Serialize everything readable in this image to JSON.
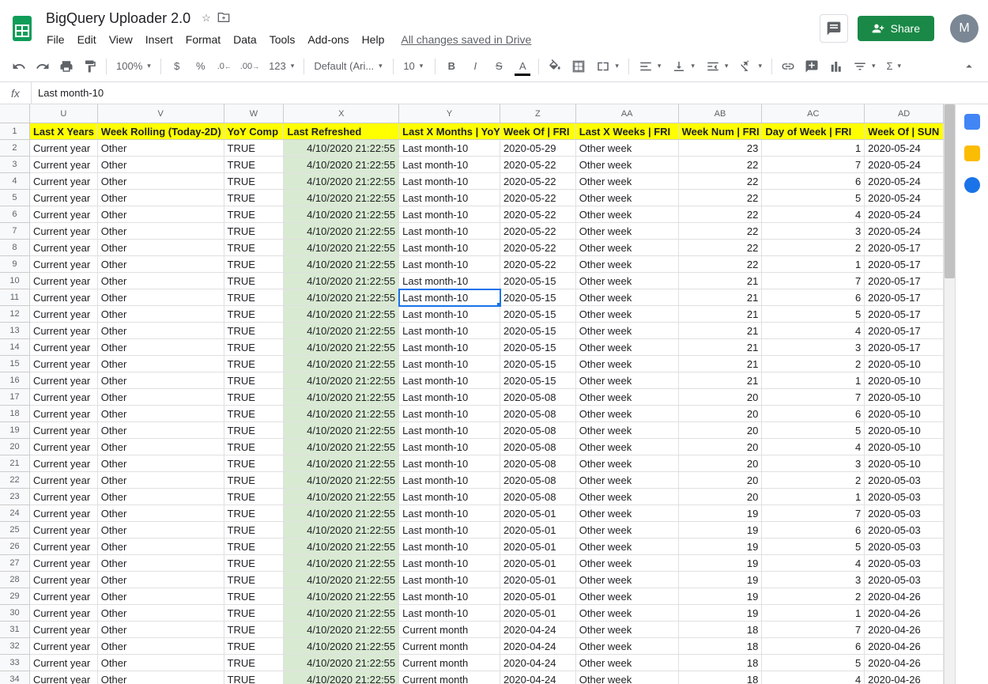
{
  "header": {
    "title": "BigQuery Uploader 2.0",
    "saved": "All changes saved in Drive",
    "share": "Share",
    "avatar": "M"
  },
  "menu": [
    "File",
    "Edit",
    "View",
    "Insert",
    "Format",
    "Data",
    "Tools",
    "Add-ons",
    "Help"
  ],
  "toolbar": {
    "zoom": "100%",
    "currency": "$",
    "percent": "%",
    "dec_dec": ".0",
    "dec_inc": ".00",
    "more_fmt": "123",
    "font": "Default (Ari...",
    "size": "10"
  },
  "formula": {
    "fx": "fx",
    "value": "Last month-10"
  },
  "columns": [
    {
      "id": "U",
      "label": "U",
      "header": "Last X Years",
      "cls": "cU"
    },
    {
      "id": "V",
      "label": "V",
      "header": "Week Rolling (Today-2D)",
      "cls": "cV"
    },
    {
      "id": "W",
      "label": "W",
      "header": "YoY Comp",
      "cls": "cW"
    },
    {
      "id": "X",
      "label": "X",
      "header": "Last Refreshed",
      "cls": "cX"
    },
    {
      "id": "Y",
      "label": "Y",
      "header": "Last X Months | YoY",
      "cls": "cY"
    },
    {
      "id": "Z",
      "label": "Z",
      "header": "Week Of | FRI",
      "cls": "cZ"
    },
    {
      "id": "AA",
      "label": "AA",
      "header": "Last X Weeks | FRI",
      "cls": "cAA"
    },
    {
      "id": "AB",
      "label": "AB",
      "header": "Week Num | FRI",
      "cls": "cAB"
    },
    {
      "id": "AC",
      "label": "AC",
      "header": "Day of Week | FRI",
      "cls": "cAC"
    },
    {
      "id": "AD",
      "label": "AD",
      "header": "Week Of | SUN",
      "cls": "cAD"
    }
  ],
  "selected": {
    "row": 11,
    "col": "Y"
  },
  "rows": [
    {
      "n": 2,
      "U": "Current year",
      "V": "Other",
      "W": "TRUE",
      "X": "4/10/2020 21:22:55",
      "Y": "Last month-10",
      "Z": "2020-05-29",
      "AA": "Other week",
      "AB": "23",
      "AC": "1",
      "AD": "2020-05-24"
    },
    {
      "n": 3,
      "U": "Current year",
      "V": "Other",
      "W": "TRUE",
      "X": "4/10/2020 21:22:55",
      "Y": "Last month-10",
      "Z": "2020-05-22",
      "AA": "Other week",
      "AB": "22",
      "AC": "7",
      "AD": "2020-05-24"
    },
    {
      "n": 4,
      "U": "Current year",
      "V": "Other",
      "W": "TRUE",
      "X": "4/10/2020 21:22:55",
      "Y": "Last month-10",
      "Z": "2020-05-22",
      "AA": "Other week",
      "AB": "22",
      "AC": "6",
      "AD": "2020-05-24"
    },
    {
      "n": 5,
      "U": "Current year",
      "V": "Other",
      "W": "TRUE",
      "X": "4/10/2020 21:22:55",
      "Y": "Last month-10",
      "Z": "2020-05-22",
      "AA": "Other week",
      "AB": "22",
      "AC": "5",
      "AD": "2020-05-24"
    },
    {
      "n": 6,
      "U": "Current year",
      "V": "Other",
      "W": "TRUE",
      "X": "4/10/2020 21:22:55",
      "Y": "Last month-10",
      "Z": "2020-05-22",
      "AA": "Other week",
      "AB": "22",
      "AC": "4",
      "AD": "2020-05-24"
    },
    {
      "n": 7,
      "U": "Current year",
      "V": "Other",
      "W": "TRUE",
      "X": "4/10/2020 21:22:55",
      "Y": "Last month-10",
      "Z": "2020-05-22",
      "AA": "Other week",
      "AB": "22",
      "AC": "3",
      "AD": "2020-05-24"
    },
    {
      "n": 8,
      "U": "Current year",
      "V": "Other",
      "W": "TRUE",
      "X": "4/10/2020 21:22:55",
      "Y": "Last month-10",
      "Z": "2020-05-22",
      "AA": "Other week",
      "AB": "22",
      "AC": "2",
      "AD": "2020-05-17"
    },
    {
      "n": 9,
      "U": "Current year",
      "V": "Other",
      "W": "TRUE",
      "X": "4/10/2020 21:22:55",
      "Y": "Last month-10",
      "Z": "2020-05-22",
      "AA": "Other week",
      "AB": "22",
      "AC": "1",
      "AD": "2020-05-17"
    },
    {
      "n": 10,
      "U": "Current year",
      "V": "Other",
      "W": "TRUE",
      "X": "4/10/2020 21:22:55",
      "Y": "Last month-10",
      "Z": "2020-05-15",
      "AA": "Other week",
      "AB": "21",
      "AC": "7",
      "AD": "2020-05-17"
    },
    {
      "n": 11,
      "U": "Current year",
      "V": "Other",
      "W": "TRUE",
      "X": "4/10/2020 21:22:55",
      "Y": "Last month-10",
      "Z": "2020-05-15",
      "AA": "Other week",
      "AB": "21",
      "AC": "6",
      "AD": "2020-05-17"
    },
    {
      "n": 12,
      "U": "Current year",
      "V": "Other",
      "W": "TRUE",
      "X": "4/10/2020 21:22:55",
      "Y": "Last month-10",
      "Z": "2020-05-15",
      "AA": "Other week",
      "AB": "21",
      "AC": "5",
      "AD": "2020-05-17"
    },
    {
      "n": 13,
      "U": "Current year",
      "V": "Other",
      "W": "TRUE",
      "X": "4/10/2020 21:22:55",
      "Y": "Last month-10",
      "Z": "2020-05-15",
      "AA": "Other week",
      "AB": "21",
      "AC": "4",
      "AD": "2020-05-17"
    },
    {
      "n": 14,
      "U": "Current year",
      "V": "Other",
      "W": "TRUE",
      "X": "4/10/2020 21:22:55",
      "Y": "Last month-10",
      "Z": "2020-05-15",
      "AA": "Other week",
      "AB": "21",
      "AC": "3",
      "AD": "2020-05-17"
    },
    {
      "n": 15,
      "U": "Current year",
      "V": "Other",
      "W": "TRUE",
      "X": "4/10/2020 21:22:55",
      "Y": "Last month-10",
      "Z": "2020-05-15",
      "AA": "Other week",
      "AB": "21",
      "AC": "2",
      "AD": "2020-05-10"
    },
    {
      "n": 16,
      "U": "Current year",
      "V": "Other",
      "W": "TRUE",
      "X": "4/10/2020 21:22:55",
      "Y": "Last month-10",
      "Z": "2020-05-15",
      "AA": "Other week",
      "AB": "21",
      "AC": "1",
      "AD": "2020-05-10"
    },
    {
      "n": 17,
      "U": "Current year",
      "V": "Other",
      "W": "TRUE",
      "X": "4/10/2020 21:22:55",
      "Y": "Last month-10",
      "Z": "2020-05-08",
      "AA": "Other week",
      "AB": "20",
      "AC": "7",
      "AD": "2020-05-10"
    },
    {
      "n": 18,
      "U": "Current year",
      "V": "Other",
      "W": "TRUE",
      "X": "4/10/2020 21:22:55",
      "Y": "Last month-10",
      "Z": "2020-05-08",
      "AA": "Other week",
      "AB": "20",
      "AC": "6",
      "AD": "2020-05-10"
    },
    {
      "n": 19,
      "U": "Current year",
      "V": "Other",
      "W": "TRUE",
      "X": "4/10/2020 21:22:55",
      "Y": "Last month-10",
      "Z": "2020-05-08",
      "AA": "Other week",
      "AB": "20",
      "AC": "5",
      "AD": "2020-05-10"
    },
    {
      "n": 20,
      "U": "Current year",
      "V": "Other",
      "W": "TRUE",
      "X": "4/10/2020 21:22:55",
      "Y": "Last month-10",
      "Z": "2020-05-08",
      "AA": "Other week",
      "AB": "20",
      "AC": "4",
      "AD": "2020-05-10"
    },
    {
      "n": 21,
      "U": "Current year",
      "V": "Other",
      "W": "TRUE",
      "X": "4/10/2020 21:22:55",
      "Y": "Last month-10",
      "Z": "2020-05-08",
      "AA": "Other week",
      "AB": "20",
      "AC": "3",
      "AD": "2020-05-10"
    },
    {
      "n": 22,
      "U": "Current year",
      "V": "Other",
      "W": "TRUE",
      "X": "4/10/2020 21:22:55",
      "Y": "Last month-10",
      "Z": "2020-05-08",
      "AA": "Other week",
      "AB": "20",
      "AC": "2",
      "AD": "2020-05-03"
    },
    {
      "n": 23,
      "U": "Current year",
      "V": "Other",
      "W": "TRUE",
      "X": "4/10/2020 21:22:55",
      "Y": "Last month-10",
      "Z": "2020-05-08",
      "AA": "Other week",
      "AB": "20",
      "AC": "1",
      "AD": "2020-05-03"
    },
    {
      "n": 24,
      "U": "Current year",
      "V": "Other",
      "W": "TRUE",
      "X": "4/10/2020 21:22:55",
      "Y": "Last month-10",
      "Z": "2020-05-01",
      "AA": "Other week",
      "AB": "19",
      "AC": "7",
      "AD": "2020-05-03"
    },
    {
      "n": 25,
      "U": "Current year",
      "V": "Other",
      "W": "TRUE",
      "X": "4/10/2020 21:22:55",
      "Y": "Last month-10",
      "Z": "2020-05-01",
      "AA": "Other week",
      "AB": "19",
      "AC": "6",
      "AD": "2020-05-03"
    },
    {
      "n": 26,
      "U": "Current year",
      "V": "Other",
      "W": "TRUE",
      "X": "4/10/2020 21:22:55",
      "Y": "Last month-10",
      "Z": "2020-05-01",
      "AA": "Other week",
      "AB": "19",
      "AC": "5",
      "AD": "2020-05-03"
    },
    {
      "n": 27,
      "U": "Current year",
      "V": "Other",
      "W": "TRUE",
      "X": "4/10/2020 21:22:55",
      "Y": "Last month-10",
      "Z": "2020-05-01",
      "AA": "Other week",
      "AB": "19",
      "AC": "4",
      "AD": "2020-05-03"
    },
    {
      "n": 28,
      "U": "Current year",
      "V": "Other",
      "W": "TRUE",
      "X": "4/10/2020 21:22:55",
      "Y": "Last month-10",
      "Z": "2020-05-01",
      "AA": "Other week",
      "AB": "19",
      "AC": "3",
      "AD": "2020-05-03"
    },
    {
      "n": 29,
      "U": "Current year",
      "V": "Other",
      "W": "TRUE",
      "X": "4/10/2020 21:22:55",
      "Y": "Last month-10",
      "Z": "2020-05-01",
      "AA": "Other week",
      "AB": "19",
      "AC": "2",
      "AD": "2020-04-26"
    },
    {
      "n": 30,
      "U": "Current year",
      "V": "Other",
      "W": "TRUE",
      "X": "4/10/2020 21:22:55",
      "Y": "Last month-10",
      "Z": "2020-05-01",
      "AA": "Other week",
      "AB": "19",
      "AC": "1",
      "AD": "2020-04-26"
    },
    {
      "n": 31,
      "U": "Current year",
      "V": "Other",
      "W": "TRUE",
      "X": "4/10/2020 21:22:55",
      "Y": "Current month",
      "Z": "2020-04-24",
      "AA": "Other week",
      "AB": "18",
      "AC": "7",
      "AD": "2020-04-26"
    },
    {
      "n": 32,
      "U": "Current year",
      "V": "Other",
      "W": "TRUE",
      "X": "4/10/2020 21:22:55",
      "Y": "Current month",
      "Z": "2020-04-24",
      "AA": "Other week",
      "AB": "18",
      "AC": "6",
      "AD": "2020-04-26"
    },
    {
      "n": 33,
      "U": "Current year",
      "V": "Other",
      "W": "TRUE",
      "X": "4/10/2020 21:22:55",
      "Y": "Current month",
      "Z": "2020-04-24",
      "AA": "Other week",
      "AB": "18",
      "AC": "5",
      "AD": "2020-04-26"
    },
    {
      "n": 34,
      "U": "Current year",
      "V": "Other",
      "W": "TRUE",
      "X": "4/10/2020 21:22:55",
      "Y": "Current month",
      "Z": "2020-04-24",
      "AA": "Other week",
      "AB": "18",
      "AC": "4",
      "AD": "2020-04-26"
    }
  ]
}
